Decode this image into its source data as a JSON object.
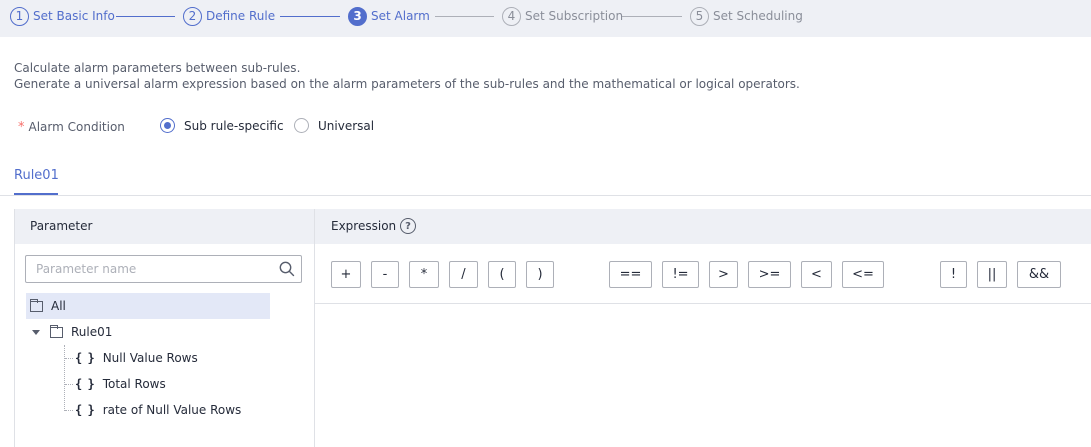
{
  "stepper": {
    "steps": [
      {
        "num": "1",
        "label": "Set Basic Info",
        "state": "done"
      },
      {
        "num": "2",
        "label": "Define Rule",
        "state": "done"
      },
      {
        "num": "3",
        "label": "Set Alarm",
        "state": "active"
      },
      {
        "num": "4",
        "label": "Set Subscription",
        "state": "todo"
      },
      {
        "num": "5",
        "label": "Set Scheduling",
        "state": "todo"
      }
    ]
  },
  "description": {
    "line1": "Calculate alarm parameters between sub-rules.",
    "line2": "Generate a universal alarm expression based on the alarm parameters of the sub-rules and the mathematical or logical operators."
  },
  "alarm_condition": {
    "required_mark": "*",
    "label": "Alarm Condition",
    "options": [
      {
        "label": "Sub rule-specific",
        "selected": true
      },
      {
        "label": "Universal",
        "selected": false
      }
    ]
  },
  "tabs": [
    {
      "label": "Rule01",
      "active": true
    }
  ],
  "parameter_panel": {
    "header": "Parameter",
    "search_placeholder": "Parameter name",
    "tree": {
      "root": "All",
      "group": "Rule01",
      "items": [
        "Null Value Rows",
        "Total Rows",
        "rate of Null Value Rows"
      ],
      "item_icon": "{ }"
    }
  },
  "expression_panel": {
    "header": "Expression",
    "help_icon": "?",
    "operators": [
      "+",
      "-",
      "*",
      "/",
      "(",
      ")",
      "==",
      "!=",
      ">",
      ">=",
      "<",
      "<=",
      "!",
      "||",
      "&&"
    ]
  },
  "colors": {
    "accent": "#526ecc",
    "header_bg": "#eef0f5",
    "required": "#f66f6a",
    "border": "#adb0b8"
  }
}
